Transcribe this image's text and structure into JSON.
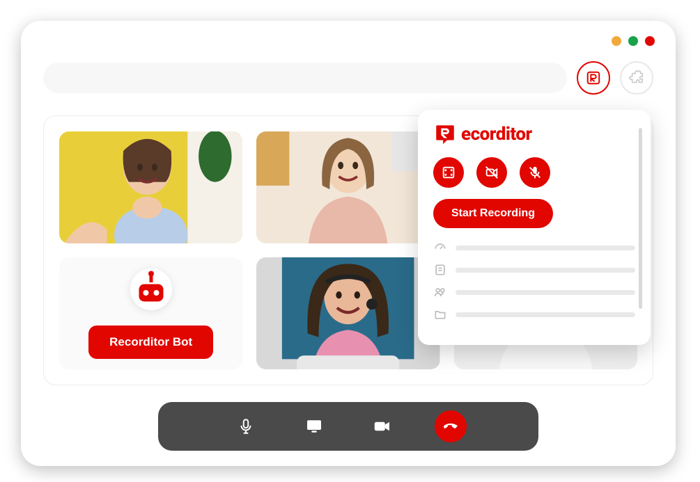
{
  "popup": {
    "brand": "ecorditor",
    "start_recording": "Start Recording",
    "options": [
      "fullscreen-icon",
      "camera-disabled-icon",
      "mic-muted-icon"
    ],
    "menu": [
      "speed-icon",
      "notes-icon",
      "people-icon",
      "folder-icon"
    ]
  },
  "bot": {
    "label": "Recorditor Bot"
  },
  "colors": {
    "brand": "#e10600",
    "bar": "#4a4a4a"
  }
}
